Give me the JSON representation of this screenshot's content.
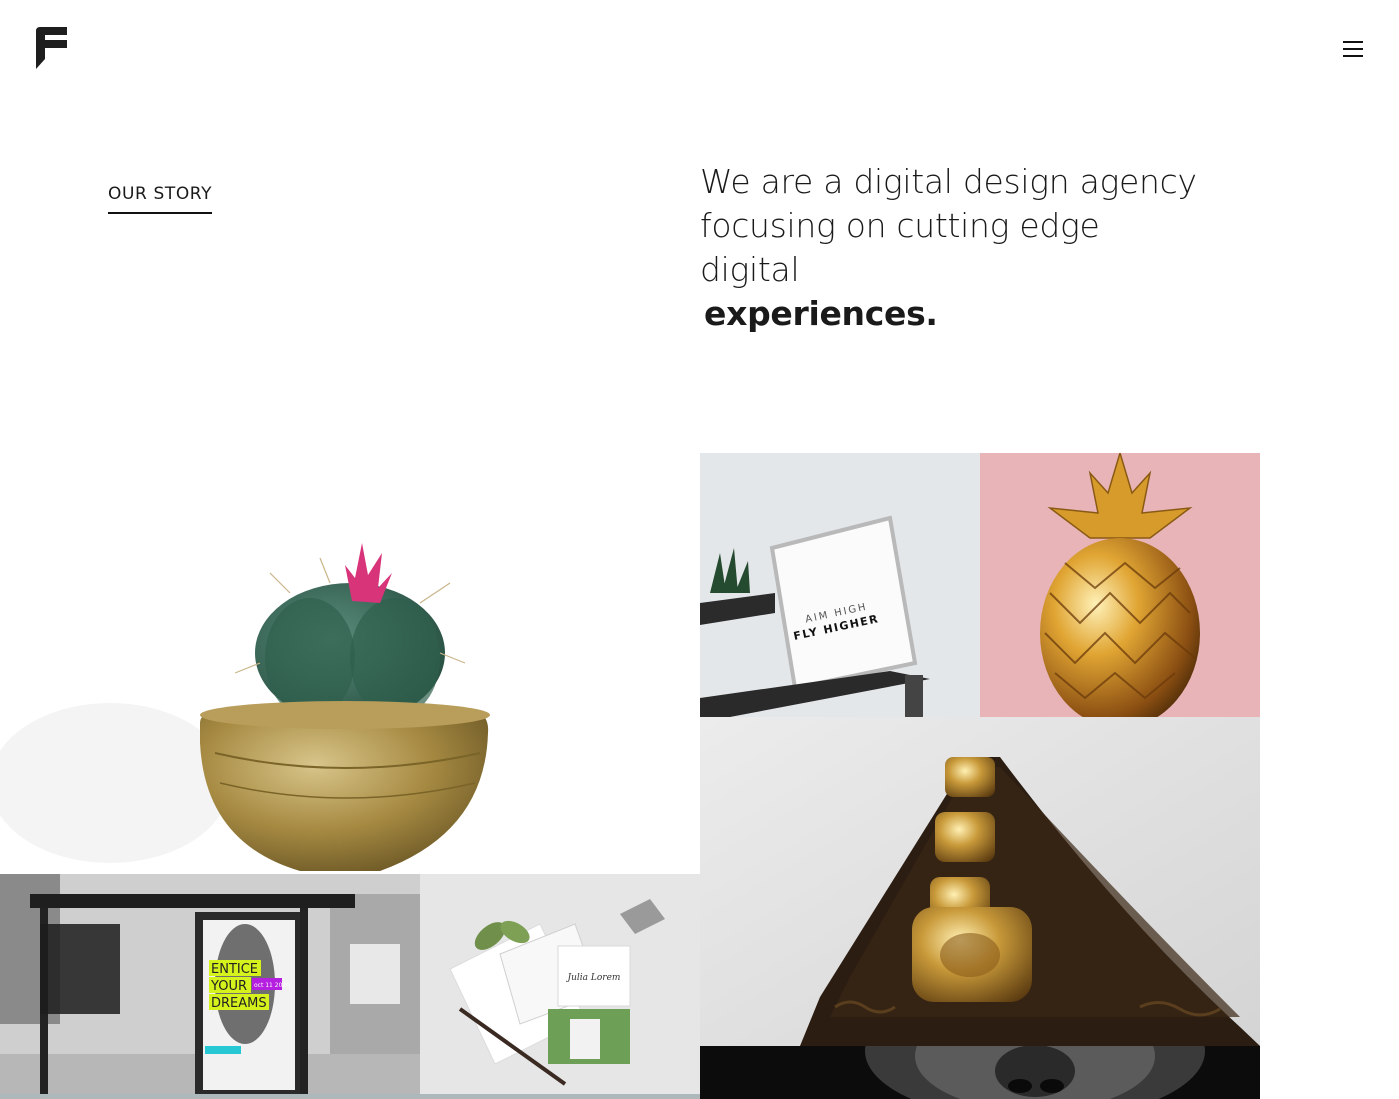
{
  "header": {
    "logo_icon": "agency-logo-icon",
    "menu_icon": "hamburger-menu-icon"
  },
  "intro": {
    "section_label": "OUR STORY",
    "headline_part1": "We are a digital design agency focusing on cutting edge digital",
    "headline_emphasis": "experiences."
  },
  "gallery": {
    "shelf_frame_line1": "AIM HIGH",
    "shelf_frame_line2": "FLY HIGHER",
    "poster_line1": "ENTICE",
    "poster_line2": "YOUR",
    "poster_line3": "DREAMS",
    "poster_date": "oct 11 2020",
    "card_signature": "Julia Lorem"
  },
  "colors": {
    "text": "#1a1a1a",
    "background": "#ffffff",
    "pink_tile": "#e9b5b8",
    "gold": "#c99a3a",
    "poster_accent_yellow": "#d6f21c",
    "poster_accent_purple": "#b51fe0",
    "poster_accent_cyan": "#27c7d3"
  }
}
